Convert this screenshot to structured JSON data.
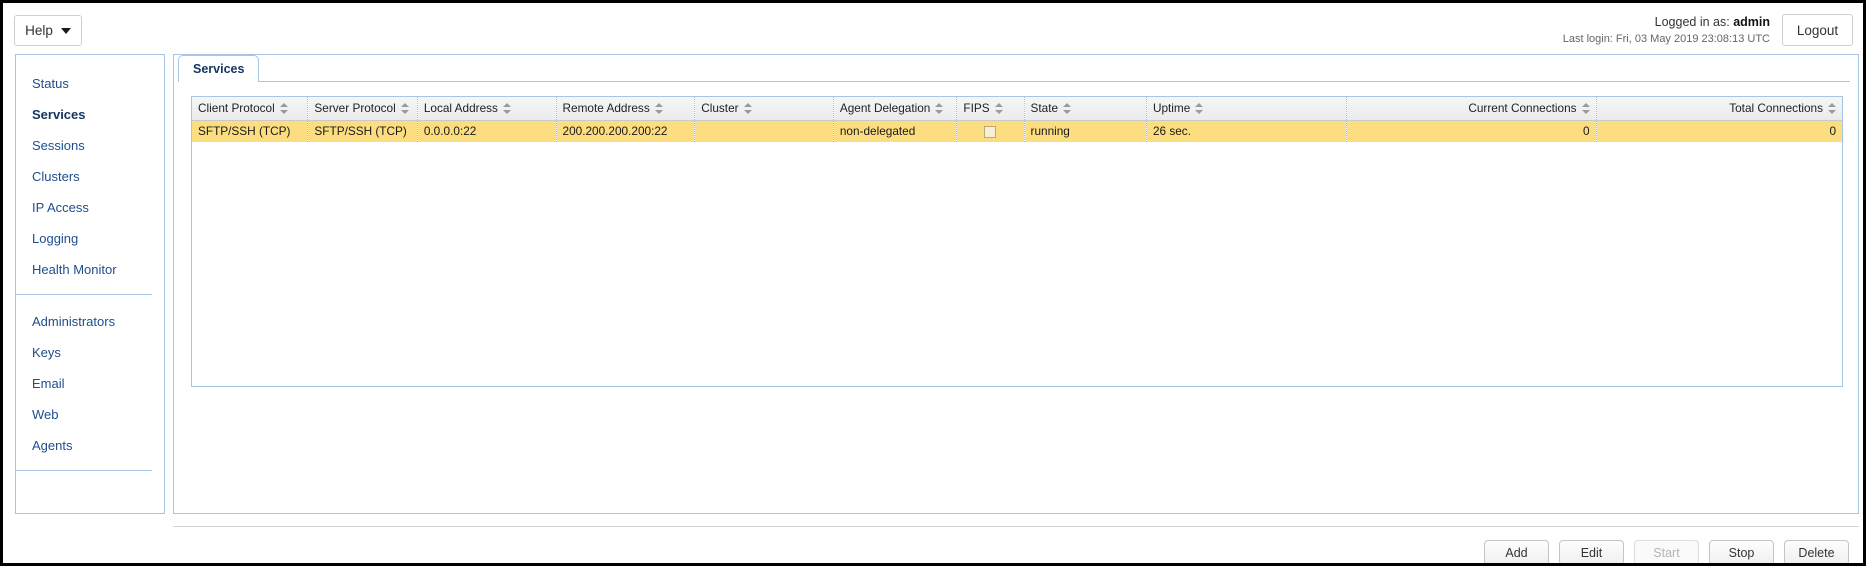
{
  "topbar": {
    "help_label": "Help",
    "logged_in_prefix": "Logged in as:",
    "username": "admin",
    "last_login": "Last login: Fri, 03 May 2019 23:08:13 UTC",
    "logout_label": "Logout"
  },
  "sidebar": {
    "group1": [
      {
        "label": "Status",
        "active": false
      },
      {
        "label": "Services",
        "active": true
      },
      {
        "label": "Sessions",
        "active": false
      },
      {
        "label": "Clusters",
        "active": false
      },
      {
        "label": "IP Access",
        "active": false
      },
      {
        "label": "Logging",
        "active": false
      },
      {
        "label": "Health Monitor",
        "active": false
      }
    ],
    "group2": [
      {
        "label": "Administrators"
      },
      {
        "label": "Keys"
      },
      {
        "label": "Email"
      },
      {
        "label": "Web"
      },
      {
        "label": "Agents"
      }
    ]
  },
  "tabs": [
    {
      "label": "Services",
      "active": true
    }
  ],
  "table": {
    "columns": [
      {
        "label": "Client Protocol",
        "align": "left"
      },
      {
        "label": "Server Protocol",
        "align": "left"
      },
      {
        "label": "Local Address",
        "align": "left"
      },
      {
        "label": "Remote Address",
        "align": "left"
      },
      {
        "label": "Cluster",
        "align": "left"
      },
      {
        "label": "Agent Delegation",
        "align": "left"
      },
      {
        "label": "FIPS",
        "align": "left"
      },
      {
        "label": "State",
        "align": "left"
      },
      {
        "label": "Uptime",
        "align": "left"
      },
      {
        "label": "Current Connections",
        "align": "right"
      },
      {
        "label": "Total Connections",
        "align": "right"
      }
    ],
    "rows": [
      {
        "selected": true,
        "client_protocol": "SFTP/SSH (TCP)",
        "server_protocol": "SFTP/SSH (TCP)",
        "local_address": "0.0.0.0:22",
        "remote_address": "200.200.200.200:22",
        "cluster": "",
        "agent_delegation": "non-delegated",
        "fips_checked": false,
        "state": "running",
        "uptime": "26 sec.",
        "current_connections": "0",
        "total_connections": "0"
      }
    ]
  },
  "actions": [
    {
      "label": "Add",
      "disabled": false
    },
    {
      "label": "Edit",
      "disabled": false
    },
    {
      "label": "Start",
      "disabled": true
    },
    {
      "label": "Stop",
      "disabled": false
    },
    {
      "label": "Delete",
      "disabled": false
    }
  ]
}
